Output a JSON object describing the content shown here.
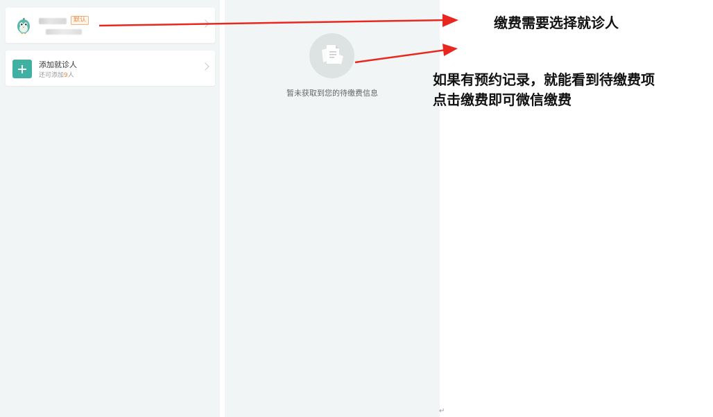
{
  "patient_card": {
    "default_badge": "默认"
  },
  "add_card": {
    "title": "添加就诊人",
    "sub_prefix": "还可添加",
    "sub_count": "9",
    "sub_suffix": "人"
  },
  "payment_panel": {
    "empty_message": "暂未获取到您的待缴费信息"
  },
  "annotations": {
    "note_1": "缴费需要选择就诊人",
    "note_2_line_1": "如果有预约记录，就能看到待缴费项",
    "note_2_line_2": "点击缴费即可微信缴费",
    "arrow_color": "#e8271f"
  },
  "colors": {
    "accent": "#3fb0a2",
    "badge_orange": "#f08a3c",
    "panel_bg": "#f1f5f5"
  },
  "icons": {
    "avatar": "bird-mascot-icon",
    "add": "plus-icon",
    "chevron": "chevron-right-icon",
    "empty": "document-icon"
  }
}
